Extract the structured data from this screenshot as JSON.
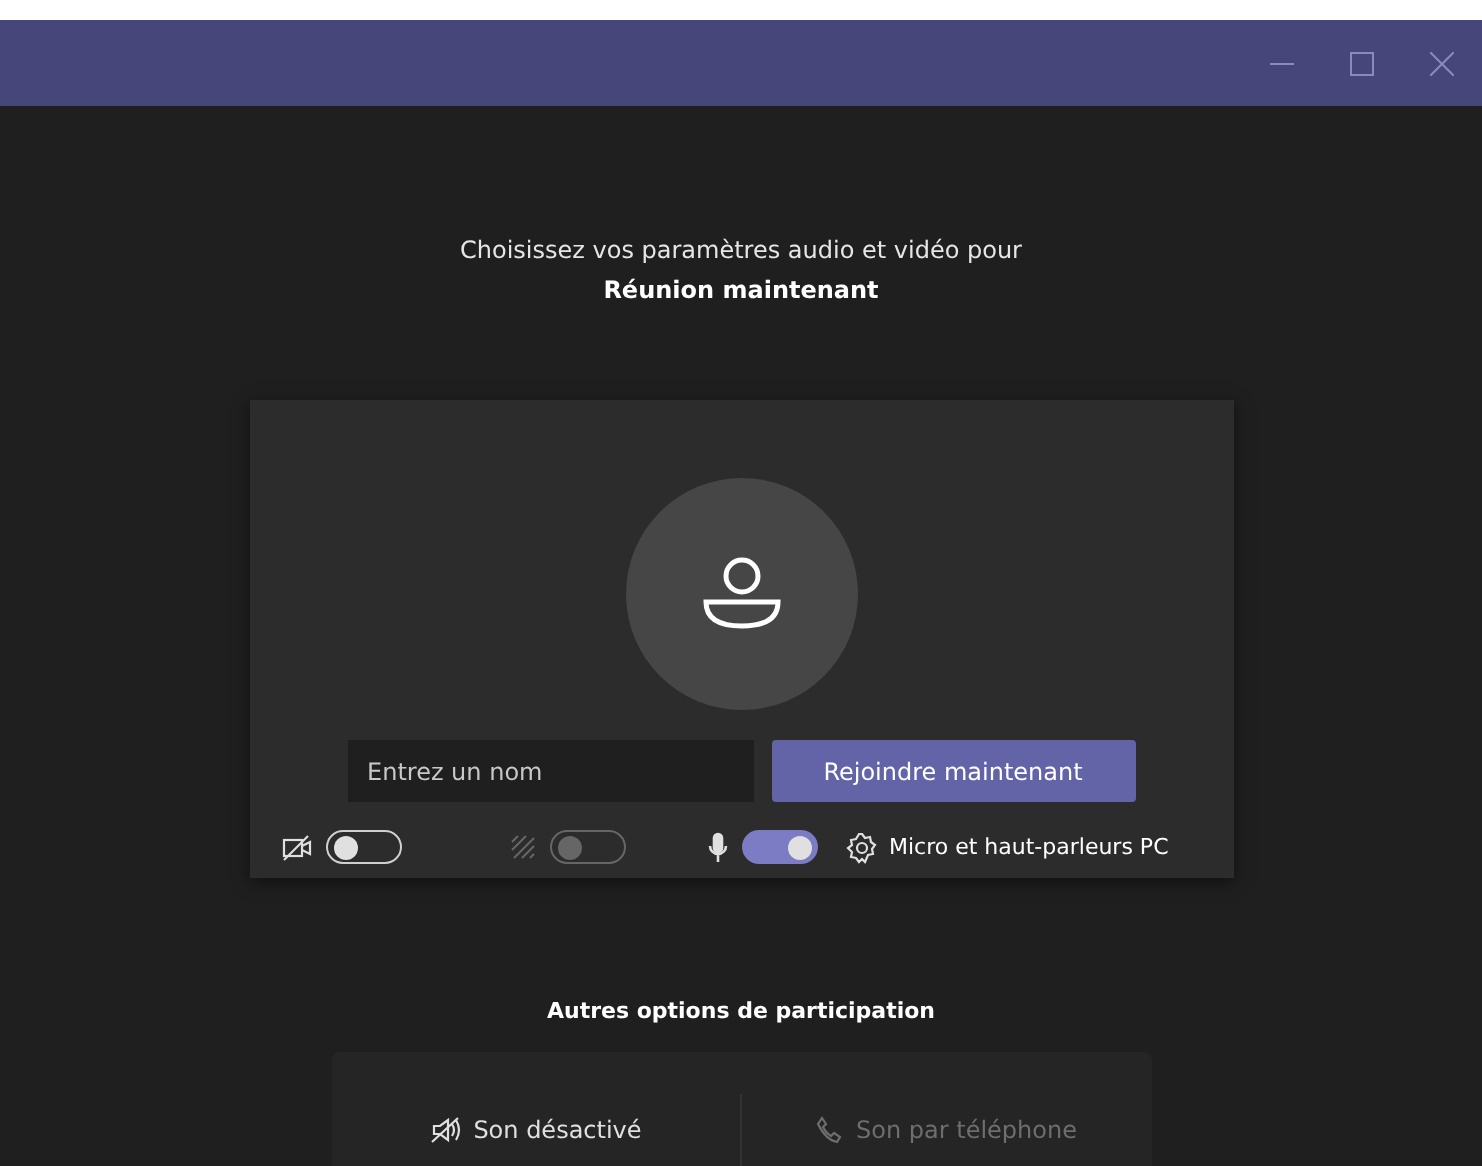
{
  "window": {
    "controls": [
      {
        "kind": "minimize"
      },
      {
        "kind": "maximize"
      },
      {
        "kind": "close"
      }
    ]
  },
  "prompt": {
    "line": "Choisissez vos paramètres audio et vidéo pour",
    "meeting": "Réunion maintenant"
  },
  "join": {
    "name_placeholder": "Entrez un nom",
    "button": "Rejoindre maintenant"
  },
  "toggles": [
    {
      "kind": "camera",
      "on": false,
      "disabled": false
    },
    {
      "kind": "blur",
      "on": false,
      "disabled": true
    },
    {
      "kind": "mic",
      "on": true,
      "disabled": false
    }
  ],
  "device": {
    "label": "Micro et haut-parleurs PC"
  },
  "other": {
    "title": "Autres options de participation",
    "options": [
      {
        "kind": "audio-off",
        "label": "Son désactivé",
        "disabled": false
      },
      {
        "kind": "phone",
        "label": "Son par téléphone",
        "disabled": true
      }
    ]
  }
}
